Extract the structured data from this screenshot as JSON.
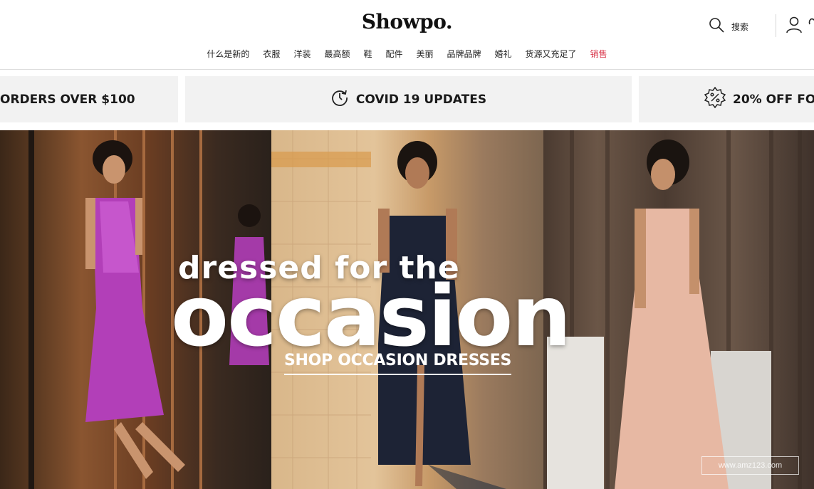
{
  "header": {
    "logo": "Showpo.",
    "search_label": "搜索",
    "icons": [
      "search-icon",
      "user-icon",
      "heart-icon"
    ]
  },
  "nav": {
    "items": [
      {
        "label": "什么是新的"
      },
      {
        "label": "衣服"
      },
      {
        "label": "洋装"
      },
      {
        "label": "最高额"
      },
      {
        "label": "鞋"
      },
      {
        "label": "配件"
      },
      {
        "label": "美丽"
      },
      {
        "label": "品牌品牌"
      },
      {
        "label": "婚礼"
      },
      {
        "label": "货源又充足了"
      },
      {
        "label": "销售",
        "color": "#d9354a"
      }
    ]
  },
  "promos": [
    {
      "text": "ORDERS OVER $100"
    },
    {
      "text": "COVID 19 UPDATES",
      "icon": "refresh-clock-icon"
    },
    {
      "text": "20% OFF FO",
      "icon": "percent-badge-icon"
    }
  ],
  "hero": {
    "tagline": "dressed for the",
    "headline": "occasion",
    "cta": "SHOP OCCASION DRESSES",
    "watermark": "www.amz123.com"
  },
  "colors": {
    "accent_sale": "#d9354a",
    "promo_bg": "#f2f2f2",
    "text": "#111111"
  }
}
